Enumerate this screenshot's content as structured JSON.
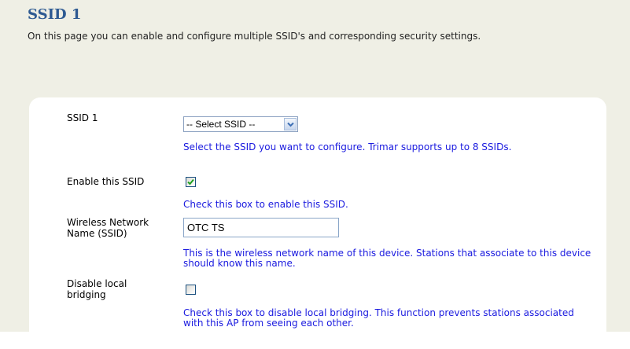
{
  "header": {
    "title": "SSID 1",
    "intro": "On this page you can enable and configure multiple SSID's and corresponding security settings."
  },
  "form": {
    "ssid_select": {
      "label": "SSID 1",
      "selected": "-- Select SSID --",
      "help": "Select the SSID you want to configure. Trimar supports up to 8 SSIDs."
    },
    "enable_ssid": {
      "label": "Enable this SSID",
      "checked": true,
      "help": "Check this box to enable this SSID."
    },
    "network_name": {
      "label_line1": "Wireless Network",
      "label_line2": "Name (SSID)",
      "value": "OTC TS",
      "help": "This is the wireless network name of this device. Stations that associate to this device should know this name."
    },
    "disable_bridging": {
      "label_line1": "Disable local",
      "label_line2": "bridging",
      "checked": false,
      "help": "Check this box to disable local bridging. This function prevents stations associated with this AP from seeing each other."
    }
  },
  "icons": {
    "dropdown": "chevron-down-icon",
    "check": "checkmark-icon"
  },
  "colors": {
    "title": "#2e5a92",
    "help_text": "#1a1adf",
    "page_background": "#efefe5",
    "panel_background": "#ffffff"
  }
}
